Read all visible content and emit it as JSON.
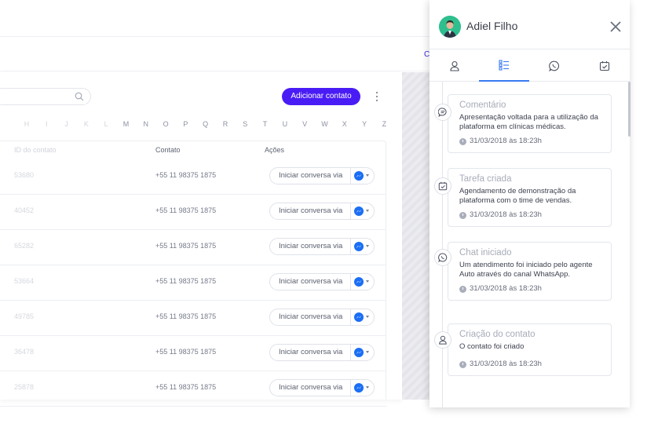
{
  "background": {
    "header_link": "C",
    "add_contact_label": "Adicionar contato",
    "alphabet": [
      "H",
      "I",
      "J",
      "K",
      "L",
      "M",
      "N",
      "O",
      "P",
      "Q",
      "R",
      "S",
      "T",
      "U",
      "V",
      "W",
      "X",
      "Y",
      "Z"
    ],
    "columns": {
      "id": "ID do contato",
      "contact": "Contato",
      "actions": "Ações"
    },
    "rows": [
      {
        "id": "53680",
        "phone": "+55 11 98375 1875",
        "action": "Iniciar conversa via"
      },
      {
        "id": "40452",
        "phone": "+55 11 98375 1875",
        "action": "Iniciar conversa via"
      },
      {
        "id": "65282",
        "phone": "+55 11 98375 1875",
        "action": "Iniciar conversa via"
      },
      {
        "id": "53664",
        "phone": "+55 11 98375 1875",
        "action": "Iniciar conversa via"
      },
      {
        "id": "49785",
        "phone": "+55 11 98375 1875",
        "action": "Iniciar conversa via"
      },
      {
        "id": "36478",
        "phone": "+55 11 98375 1875",
        "action": "Iniciar conversa via"
      },
      {
        "id": "25878",
        "phone": "+55 11 98375 1875",
        "action": "Iniciar conversa via"
      }
    ],
    "channel_icon": "messenger-icon"
  },
  "panel": {
    "contact_name": "Adiel Filho",
    "tabs": [
      {
        "icon": "user-icon",
        "active": false
      },
      {
        "icon": "list-icon",
        "active": true
      },
      {
        "icon": "whatsapp-icon",
        "active": false
      },
      {
        "icon": "task-icon",
        "active": false
      }
    ],
    "accent": "#3a7bf2",
    "events": [
      {
        "icon": "comment-icon",
        "title": "Comentário",
        "body": "Apresentação voltada para a utilização da plataforma em clínicas médicas.",
        "date": "31/03/2018 às 18:23h"
      },
      {
        "icon": "task-icon",
        "title": "Tarefa criada",
        "body": "Agendamento de demonstração da plataforma com o time de vendas.",
        "date": "31/03/2018 às 18:23h"
      },
      {
        "icon": "whatsapp-icon",
        "title": "Chat iniciado",
        "body": "Um atendimento foi iniciado pelo agente Auto através do canal WhatsApp.",
        "date": "31/03/2018 às 18:23h"
      },
      {
        "icon": "user-icon",
        "title": "Criação do contato",
        "body": "O contato foi criado",
        "date": "31/03/2018 às 18:23h"
      }
    ]
  },
  "colors": {
    "primary_button": "#4a1cf5",
    "messenger": "#1b6ef5"
  }
}
